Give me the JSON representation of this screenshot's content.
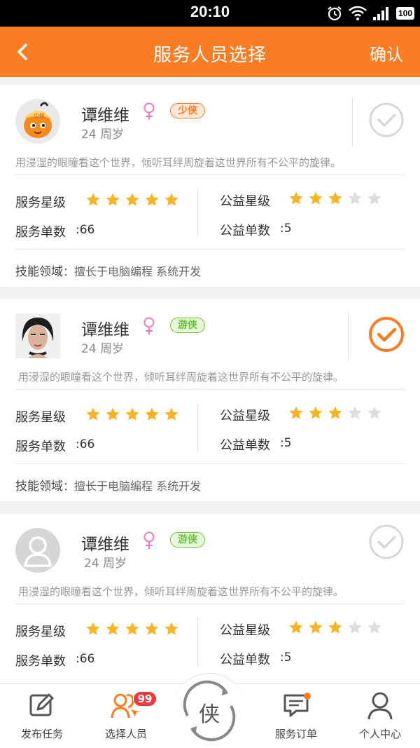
{
  "status_bar": {
    "time": "20:10",
    "battery": "100"
  },
  "header": {
    "title": "服务人员选择",
    "confirm_label": "确认"
  },
  "cards": [
    {
      "name": "谭维维",
      "badge": "少侠",
      "badge_color": "#fb7d23",
      "age": "24 周岁",
      "motto": "用浸湿的眼瞳看这个世界，倾听耳绊周旋着这世界所有不公平的旋律。",
      "service_star_label": "服务星级",
      "service_stars": 5,
      "welfare_star_label": "公益星级",
      "welfare_stars": 3,
      "service_count_label": "服务单数",
      "service_count": ":66",
      "welfare_count_label": "公益单数",
      "welfare_count": ":5",
      "skill_label": "技能领域",
      "skill_value": "：擅长于电脑编程  系统开发",
      "selected": false,
      "avatar": "orange-mascot"
    },
    {
      "name": "谭维维",
      "badge": "游侠",
      "badge_color": "#6cc33a",
      "age": "24 周岁",
      "motto": "用浸湿的眼瞳看这个世界，倾听耳绊周旋着这世界所有不公平的旋律。",
      "service_star_label": "服务星级",
      "service_stars": 5,
      "welfare_star_label": "公益星级",
      "welfare_stars": 3,
      "service_count_label": "服务单数",
      "service_count": ":66",
      "welfare_count_label": "公益单数",
      "welfare_count": ":5",
      "skill_label": "技能领域",
      "skill_value": "：擅长于电脑编程  系统开发",
      "selected": true,
      "avatar": "woman-photo"
    },
    {
      "name": "谭维维",
      "badge": "游侠",
      "badge_color": "#6cc33a",
      "age": "24 周岁",
      "motto": "用浸湿的眼瞳看这个世界，倾听耳绊周旋着这世界所有不公平的旋律。",
      "service_star_label": "服务星级",
      "service_stars": 5,
      "welfare_star_label": "公益星级",
      "welfare_stars": 3,
      "service_count_label": "服务单数",
      "service_count": ":66",
      "welfare_count_label": "公益单数",
      "welfare_count": ":5",
      "selected": false,
      "avatar": "default-person"
    }
  ],
  "nav": {
    "items": [
      {
        "label": "发布任务",
        "icon": "edit-icon"
      },
      {
        "label": "选择人员",
        "icon": "people-icon",
        "badge": "99"
      },
      {
        "label": "服务订单",
        "icon": "message-icon"
      },
      {
        "label": "个人中心",
        "icon": "user-icon"
      }
    ],
    "center_label": "侠"
  },
  "colors": {
    "accent": "#fb7d23",
    "star": "#f9b423",
    "star_empty": "#dddddd"
  }
}
